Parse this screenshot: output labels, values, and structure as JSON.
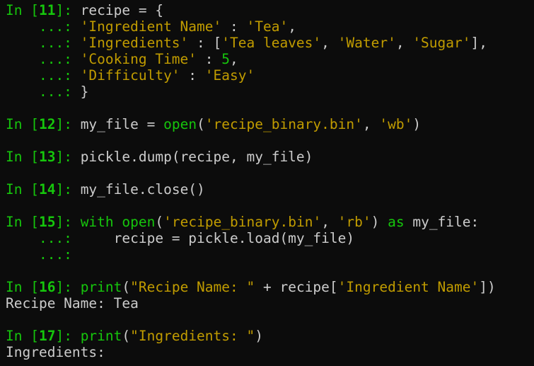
{
  "prompts": {
    "in_prefix": "In [",
    "in_suffix": "]: ",
    "cont": "    ...: ",
    "cont_bare": "    ...:"
  },
  "cell11": {
    "num": "11",
    "l0": "recipe = {",
    "l1_key": "'Ingredient Name'",
    "l1_sep": " : ",
    "l1_val": "'Tea'",
    "l1_end": ",",
    "l2_key": "'Ingredients'",
    "l2_sep": " : [",
    "l2_v1": "'Tea leaves'",
    "l2_c1": ", ",
    "l2_v2": "'Water'",
    "l2_c2": ", ",
    "l2_v3": "'Sugar'",
    "l2_end": "],",
    "l3_key": "'Cooking Time'",
    "l3_sep": " : ",
    "l3_val": "5",
    "l3_end": ",",
    "l4_key": "'Difficulty'",
    "l4_sep": " : ",
    "l4_val": "'Easy'",
    "l5": "}"
  },
  "cell12": {
    "num": "12",
    "a": "my_file = ",
    "fn": "open",
    "b": "(",
    "s1": "'recipe_binary.bin'",
    "c": ", ",
    "s2": "'wb'",
    "d": ")"
  },
  "cell13": {
    "num": "13",
    "code": "pickle.dump(recipe, my_file)"
  },
  "cell14": {
    "num": "14",
    "code": "my_file.close()"
  },
  "cell15": {
    "num": "15",
    "kw1": "with",
    "sp1": " ",
    "fn": "open",
    "b": "(",
    "s1": "'recipe_binary.bin'",
    "c": ", ",
    "s2": "'rb'",
    "d": ") ",
    "kw2": "as",
    "e": " my_file:",
    "l1": "    recipe = pickle.load(my_file)"
  },
  "cell16": {
    "num": "16",
    "fn": "print",
    "b": "(",
    "s1": "\"Recipe Name: \"",
    "c": " + recipe[",
    "s2": "'Ingredient Name'",
    "d": "])",
    "output": "Recipe Name: Tea"
  },
  "cell17": {
    "num": "17",
    "fn": "print",
    "b": "(",
    "s1": "\"Ingredients: \"",
    "d": ")",
    "output": "Ingredients:"
  }
}
